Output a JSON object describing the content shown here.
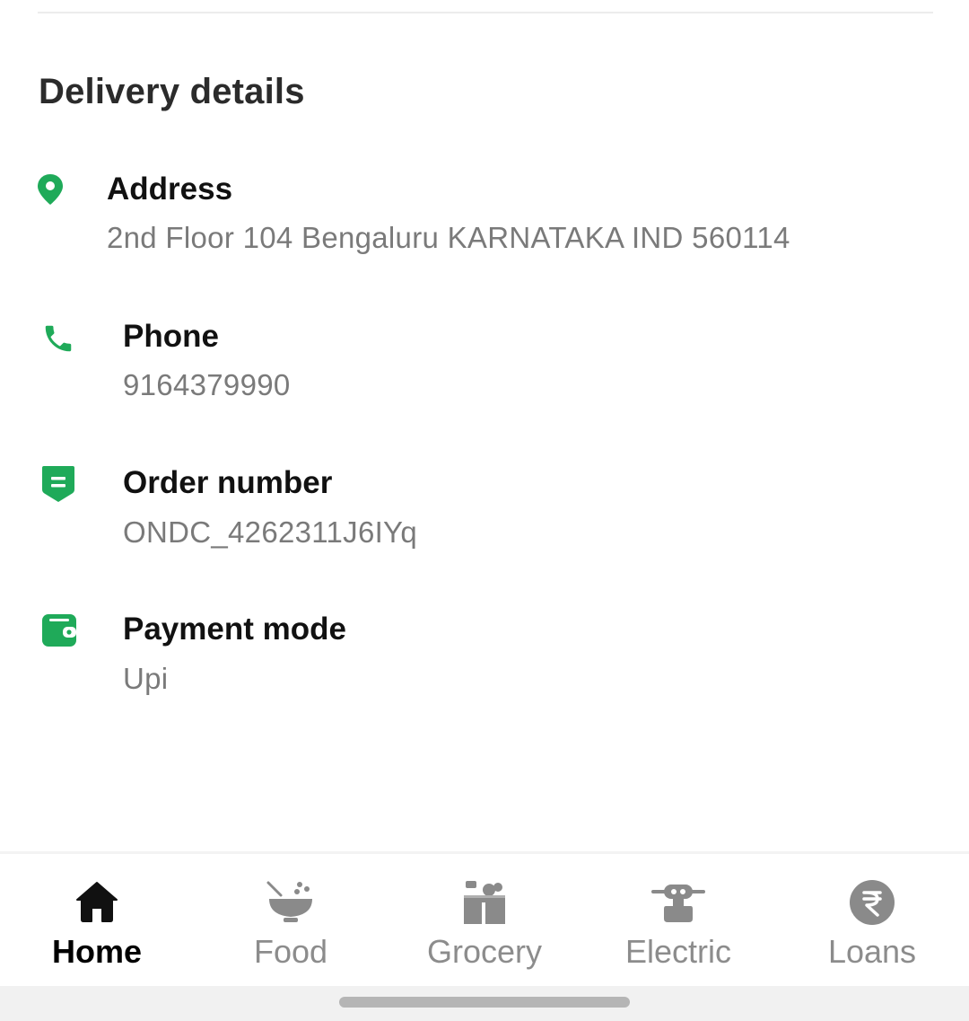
{
  "section": {
    "title": "Delivery details"
  },
  "details": [
    {
      "icon": "location-pin-icon",
      "label": "Address",
      "value": "2nd Floor 104 Bengaluru KARNATAKA IND 560114"
    },
    {
      "icon": "phone-icon",
      "label": "Phone",
      "value": "9164379990"
    },
    {
      "icon": "receipt-icon",
      "label": "Order number",
      "value": "ONDC_4262311J6IYq"
    },
    {
      "icon": "wallet-icon",
      "label": "Payment mode",
      "value": "Upi"
    }
  ],
  "bottom_nav": {
    "active": "Home",
    "items": [
      {
        "icon": "home-icon",
        "label": "Home"
      },
      {
        "icon": "food-bowl-icon",
        "label": "Food"
      },
      {
        "icon": "grocery-bag-icon",
        "label": "Grocery"
      },
      {
        "icon": "scooter-icon",
        "label": "Electric"
      },
      {
        "icon": "rupee-icon",
        "label": "Loans"
      }
    ]
  },
  "colors": {
    "accent": "#1faa59",
    "active_nav": "#000000",
    "inactive_nav": "#8c8c8c",
    "value_text": "#7a7a7a"
  }
}
